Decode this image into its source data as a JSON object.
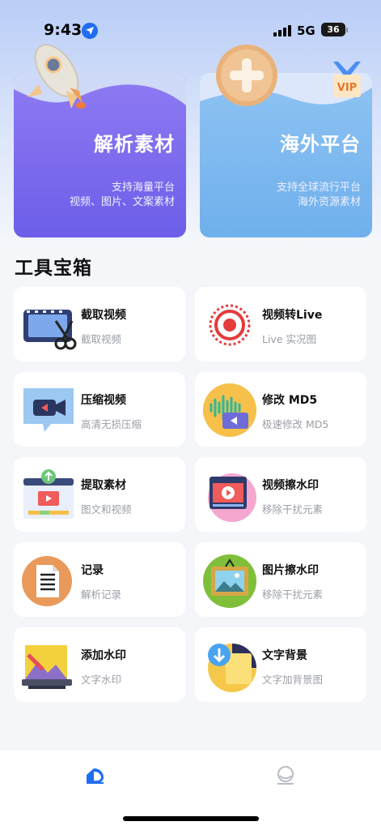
{
  "status_bar": {
    "time": "9:43",
    "network": "5G",
    "battery": "36"
  },
  "banners": [
    {
      "title": "解析素材",
      "subtitle_line1": "支持海量平台",
      "subtitle_line2": "视频、图片、文案素材",
      "icon": "rocket-icon"
    },
    {
      "title": "海外平台",
      "subtitle_line1": "支持全球流行平台",
      "subtitle_line2": "海外资源素材",
      "icon": "plus-coin-icon",
      "badge": "VIP"
    }
  ],
  "section_title": "工具宝箱",
  "tools": [
    {
      "name": "截取视频",
      "sub": "截取视频",
      "icon": "video-cut-icon"
    },
    {
      "name": "视频转Live",
      "sub": "Live 实况图",
      "icon": "live-target-icon"
    },
    {
      "name": "压缩视频",
      "sub": "高清无损压缩",
      "icon": "video-camera-icon"
    },
    {
      "name": "修改 MD5",
      "sub": "极速修改 MD5",
      "icon": "audio-video-icon"
    },
    {
      "name": "提取素材",
      "sub": "图文和视频",
      "icon": "browser-upload-icon"
    },
    {
      "name": "视频擦水印",
      "sub": "移除干扰元素",
      "icon": "video-player-icon"
    },
    {
      "name": "记录",
      "sub": "解析记录",
      "icon": "document-icon"
    },
    {
      "name": "图片擦水印",
      "sub": "移除干扰元素",
      "icon": "picture-frame-icon"
    },
    {
      "name": "添加水印",
      "sub": "文字水印",
      "icon": "laptop-image-icon"
    },
    {
      "name": "文字背景",
      "sub": "文字加背景图",
      "icon": "download-badge-icon"
    }
  ],
  "tab_bar": {
    "items": [
      {
        "icon": "home-icon",
        "active": true
      },
      {
        "icon": "profile-icon",
        "active": false
      }
    ]
  },
  "colors": {
    "accent": "#1f6df2",
    "banner_left": "#7463ec",
    "banner_right": "#7db8ef"
  }
}
